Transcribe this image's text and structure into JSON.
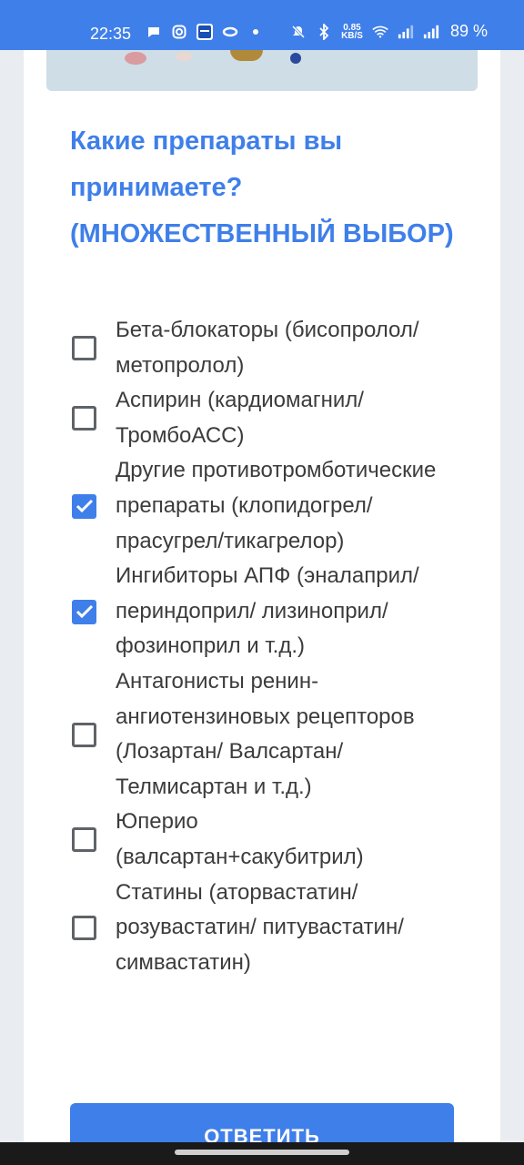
{
  "status_bar": {
    "time": "22:35",
    "net_speed_value": "0.85",
    "net_speed_unit": "KB/S",
    "battery": "89 %",
    "icons": [
      "chat-icon",
      "instagram-icon",
      "de-app-icon",
      "ring-icon",
      "dot-icon",
      "mute-icon",
      "bluetooth-icon",
      "wifi-icon",
      "signal-icon",
      "signal-icon"
    ]
  },
  "form": {
    "question": "Какие препараты вы принимаете? (МНОЖЕСТВЕННЫЙ ВЫБОР)",
    "options": [
      {
        "label": "Бета-блокаторы (бисопролол/метопролол)",
        "checked": false
      },
      {
        "label": "Аспирин (кардиомагнил/ ТромбоАСС)",
        "checked": false
      },
      {
        "label": "Другие противотромботические препараты (клопидогрел/ прасугрел/тикагрелор)",
        "checked": true
      },
      {
        "label": "Ингибиторы АПФ (эналаприл/периндоприл/ лизиноприл/фозиноприл и т.д.)",
        "checked": true
      },
      {
        "label": "Антагонисты ренин-ангиотензиновых рецепторов (Лозартан/ Валсартан/Телмисартан и т.д.)",
        "checked": false
      },
      {
        "label": "Юперио (валсартан+сакубитрил)",
        "checked": false
      },
      {
        "label": "Статины (аторвастатин/ розувастатин/ питувастатин/симвастатин)",
        "checked": false
      }
    ],
    "submit_label": "ОТВЕТИТЬ"
  },
  "colors": {
    "accent": "#3f7fe9",
    "text": "#3c3c3c",
    "checkbox_border": "#5f6368"
  }
}
